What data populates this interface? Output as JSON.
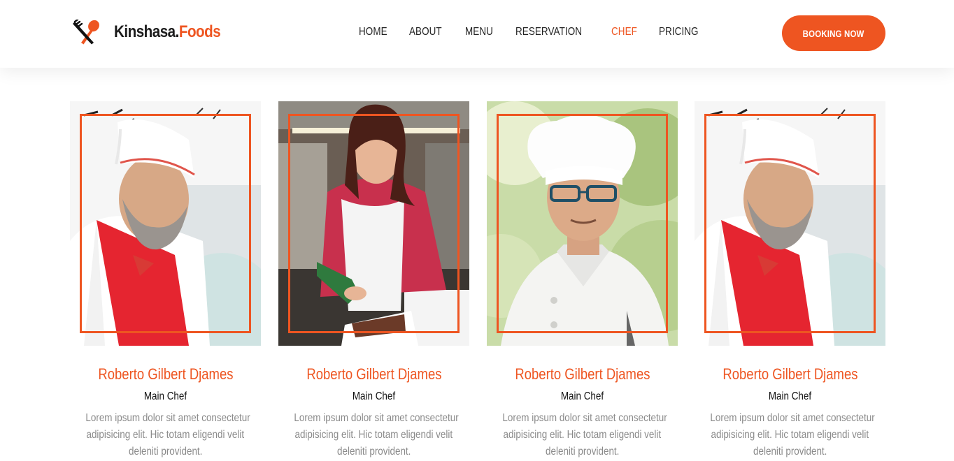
{
  "brand": {
    "name_main": "Kinshasa.",
    "name_accent": "Foods",
    "icon": "fork-spoon-icon",
    "accent_color": "#ee5521"
  },
  "nav": {
    "items": [
      {
        "label": "HOME",
        "active": false
      },
      {
        "label": "ABOUT",
        "active": false
      },
      {
        "label": "MENU",
        "active": false
      },
      {
        "label": "RESERVATION",
        "active": false
      },
      {
        "label": "CHEF",
        "active": true
      },
      {
        "label": "PRICING",
        "active": false
      }
    ]
  },
  "cta": {
    "label": "BOOKING NOW"
  },
  "chefs": [
    {
      "name": "Roberto Gilbert Djames",
      "role": "Main Chef",
      "desc_lines": [
        "Lorem ipsum dolor sit amet consectetur",
        "adipisicing elit. Hic totam eligendi velit",
        "deleniti provident."
      ],
      "photo": "bearded-chef-smiling-photo"
    },
    {
      "name": "Roberto Gilbert Djames",
      "role": "Main Chef",
      "desc_lines": [
        "Lorem ipsum dolor sit amet consectetur",
        "adipisicing elit. Hic totam eligendi velit",
        "deleniti provident."
      ],
      "photo": "woman-piping-pastry-photo"
    },
    {
      "name": "Roberto Gilbert Djames",
      "role": "Main Chef",
      "desc_lines": [
        "Lorem ipsum dolor sit amet consectetur",
        "adipisicing elit. Hic totam eligendi velit",
        "deleniti provident."
      ],
      "photo": "chef-with-glasses-photo"
    },
    {
      "name": "Roberto Gilbert Djames",
      "role": "Main Chef",
      "desc_lines": [
        "Lorem ipsum dolor sit amet consectetur",
        "adipisicing elit. Hic totam eligendi velit",
        "deleniti provident."
      ],
      "photo": "bearded-chef-smiling-photo"
    }
  ]
}
